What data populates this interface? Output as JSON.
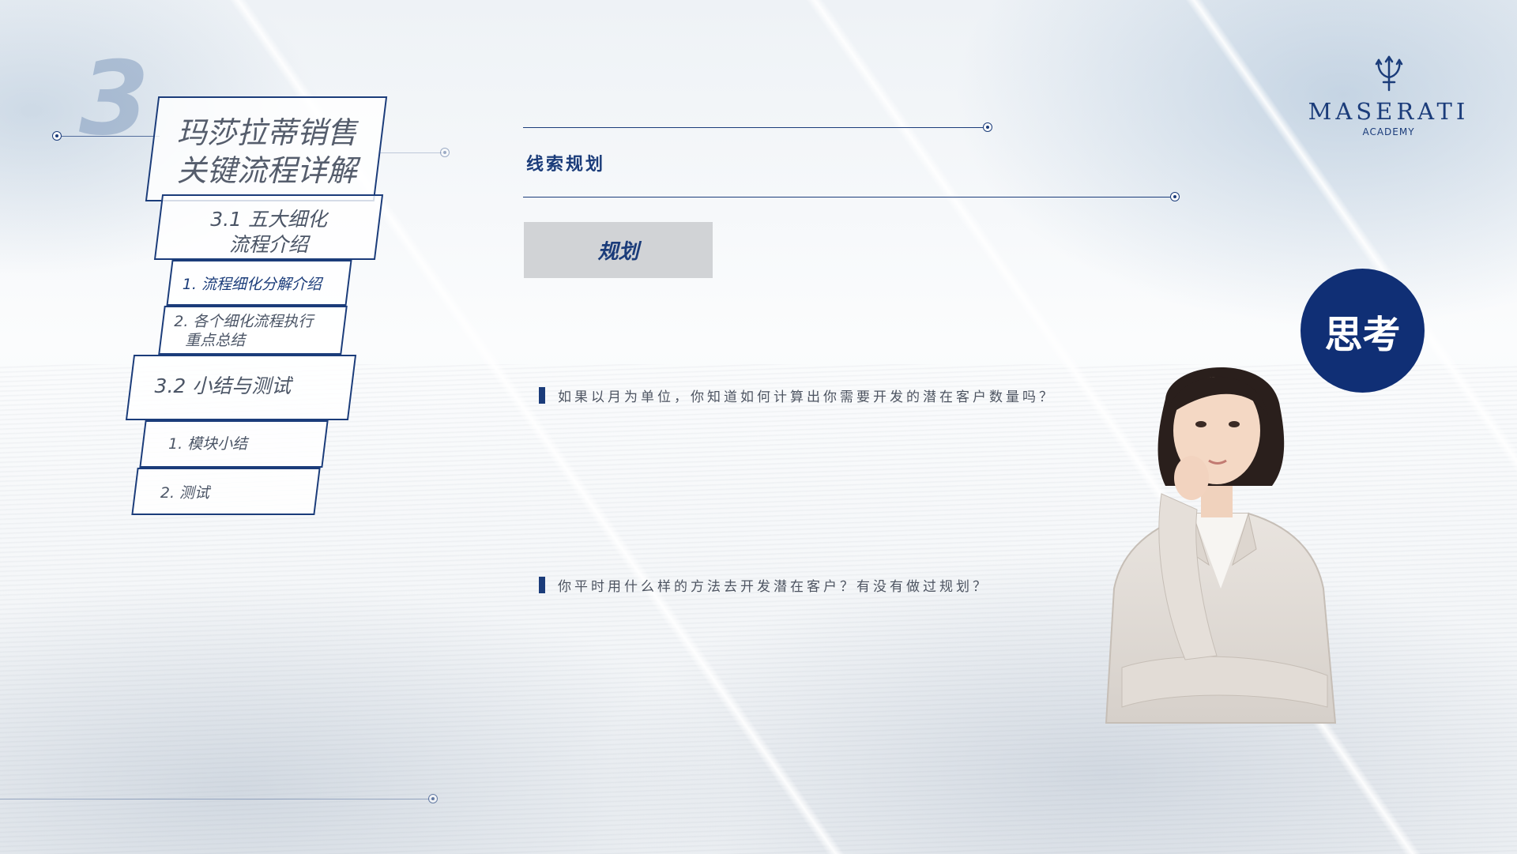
{
  "deck": {
    "section_number": "3",
    "title_line1": "玛莎拉蒂销售",
    "title_line2": "关键流程详解"
  },
  "toc": {
    "sub1_line1": "3.1   五大细化",
    "sub1_line2": "流程介绍",
    "sub1_item1": "1. 流程细化分解介绍",
    "sub1_item2_line1": "2. 各个细化流程执行",
    "sub1_item2_line2": "重点总结",
    "sub2": "3.2  小结与测试",
    "sub2_item1": "1.   模块小结",
    "sub2_item2": "2.   测试"
  },
  "content": {
    "section_title": "线索规划",
    "tag": "规划",
    "question1": "如果以月为单位，你知道如何计算出你需要开发的潜在客户数量吗？",
    "question2": "你平时用什么样的方法去开发潜在客户？有没有做过规划？"
  },
  "logo": {
    "word": "MASERATI",
    "sub": "ACADEMY"
  },
  "badge": {
    "label": "思考"
  },
  "colors": {
    "brand_navy": "#1b3c7a",
    "badge_navy": "#102f75",
    "tag_gray": "#d1d3d6"
  },
  "icons": [
    "trident-logo-icon",
    "line-endpoint-dot-icon"
  ]
}
